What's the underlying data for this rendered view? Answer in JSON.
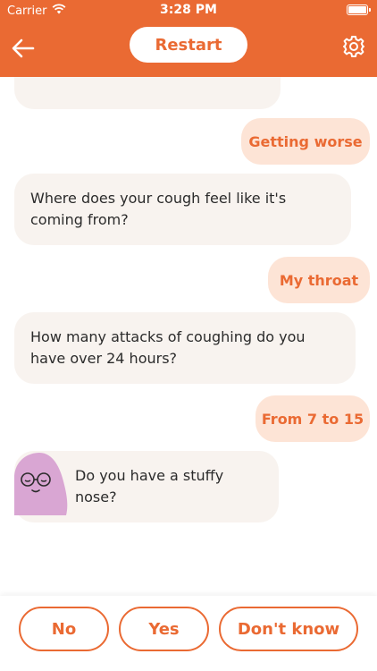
{
  "status_bar": {
    "carrier": "Carrier",
    "time": "3:28 PM"
  },
  "nav": {
    "restart_label": "Restart",
    "icons": {
      "back": "arrow-left-icon",
      "settings": "gear-icon"
    }
  },
  "chat": {
    "partial_bot": "",
    "messages": [
      {
        "role": "user",
        "text": "Getting worse"
      },
      {
        "role": "bot",
        "text": "Where does your cough feel like it's coming from?"
      },
      {
        "role": "user",
        "text": "My throat"
      },
      {
        "role": "bot",
        "text": "How many attacks of coughing do you have over 24 hours?"
      },
      {
        "role": "user",
        "text": "From 7 to 15"
      },
      {
        "role": "bot",
        "text": "Do you have a stuffy nose?"
      }
    ]
  },
  "answers": {
    "no": "No",
    "yes": "Yes",
    "dont_know": "Don't know"
  },
  "colors": {
    "accent": "#ea6a33",
    "user_bubble": "#fde4d6",
    "bot_bubble": "#f8f3ef",
    "avatar": "#d9a6d3"
  }
}
